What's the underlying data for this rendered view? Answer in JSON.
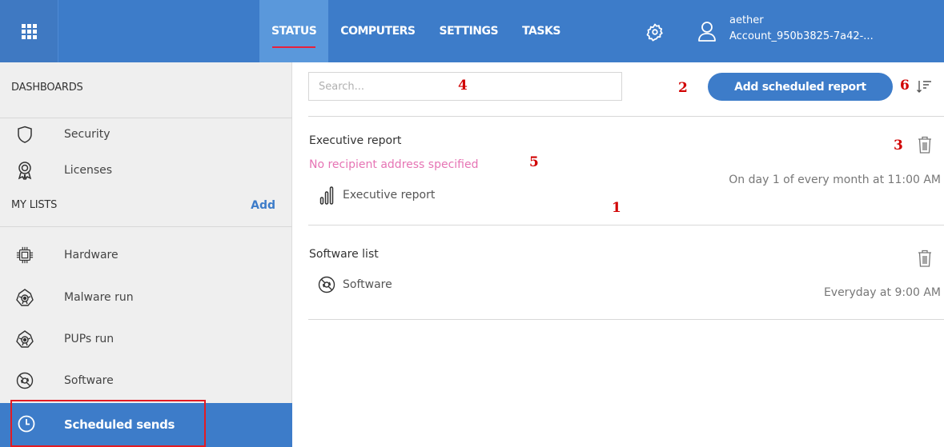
{
  "topbar": {
    "tabs": [
      "STATUS",
      "COMPUTERS",
      "SETTINGS",
      "TASKS"
    ],
    "account_line1": "aether",
    "account_line2": "Account_950b3825-7a42-..."
  },
  "sidebar": {
    "dashboards_heading": "DASHBOARDS",
    "dashboards": [
      {
        "label": "Security",
        "icon": "shield-icon"
      },
      {
        "label": "Licenses",
        "icon": "award-icon"
      }
    ],
    "my_lists_heading": "MY LISTS",
    "add_label": "Add",
    "lists": [
      {
        "label": "Hardware",
        "icon": "chip-icon"
      },
      {
        "label": "Malware run",
        "icon": "malware-icon"
      },
      {
        "label": "PUPs run",
        "icon": "pups-icon"
      },
      {
        "label": "Software",
        "icon": "software-disc-icon"
      }
    ],
    "selected": {
      "label": "Scheduled sends",
      "icon": "clock-icon"
    }
  },
  "main": {
    "search_placeholder": "Search...",
    "add_button": "Add scheduled report",
    "reports": [
      {
        "title": "Executive report",
        "warning": "No recipient address specified",
        "type_label": "Executive report",
        "type_icon": "bar-chart-icon",
        "schedule": "On day 1 of every month at 11:00 AM"
      },
      {
        "title": "Software list",
        "type_label": "Software",
        "type_icon": "software-disc-icon",
        "schedule": "Everyday at 9:00 AM"
      }
    ]
  },
  "annotations": [
    "1",
    "2",
    "3",
    "4",
    "5",
    "6"
  ],
  "colors": {
    "brand_blue": "#3d7cc9",
    "warning_pink": "#e674b4",
    "annotation_red": "#d10000"
  }
}
